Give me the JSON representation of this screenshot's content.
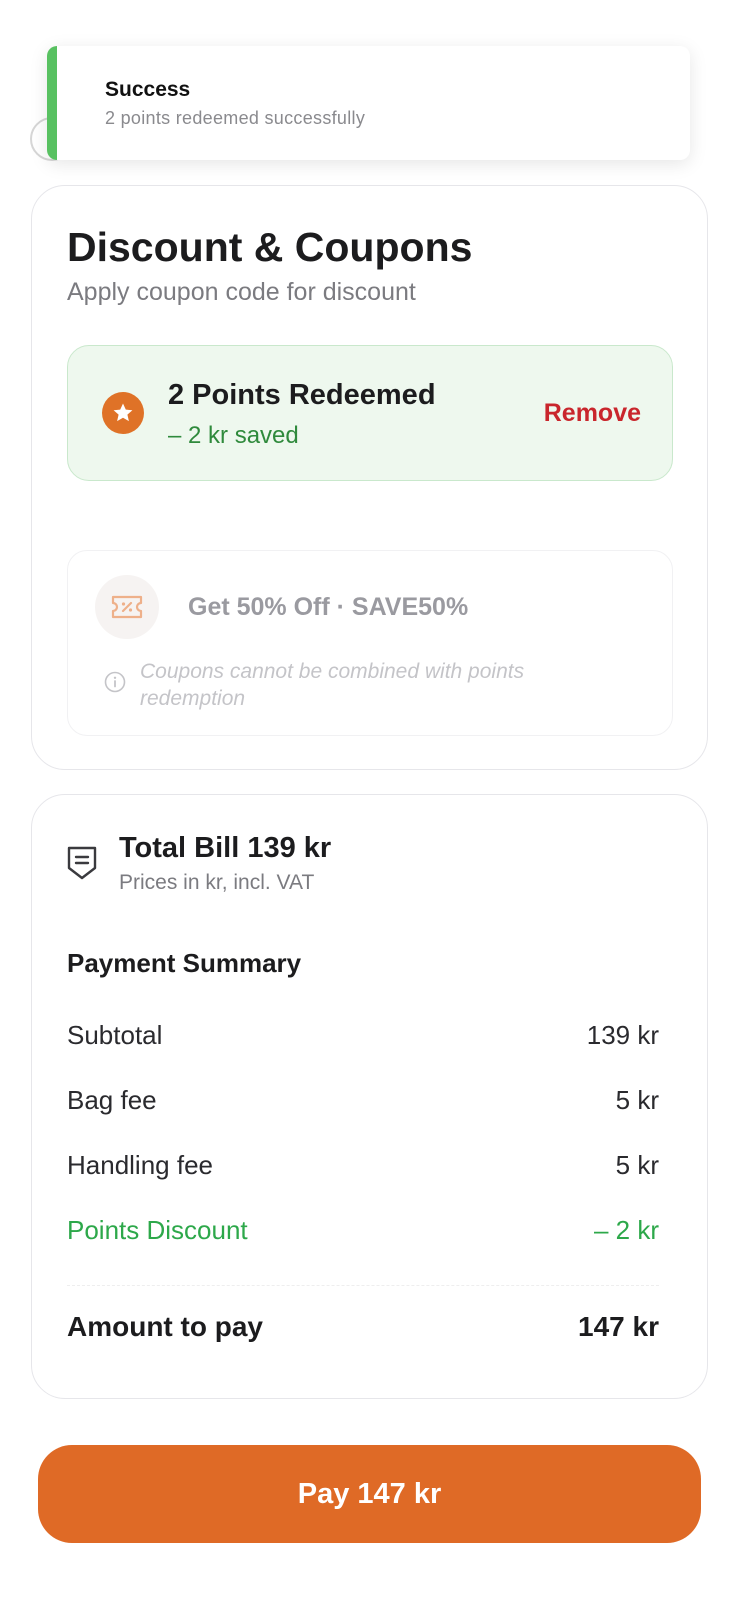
{
  "toast": {
    "title": "Success",
    "message": "2 points redeemed successfully",
    "accent_color": "#58c161"
  },
  "discount": {
    "title": "Discount & Coupons",
    "subtitle": "Apply coupon code for discount",
    "points": {
      "icon": "star-icon",
      "title": "2 Points Redeemed",
      "saved": "– 2 kr saved",
      "remove_label": "Remove"
    },
    "coupon": {
      "icon": "coupon-ticket-icon",
      "label": "Get 50% Off · SAVE50%",
      "note": "Coupons cannot be combined with points redemption",
      "disabled": true
    }
  },
  "bill": {
    "icon": "receipt-shield-icon",
    "title": "Total Bill 139 kr",
    "subtitle": "Prices in kr, incl. VAT",
    "summary_title": "Payment Summary",
    "rows": [
      {
        "label": "Subtotal",
        "value": "139 kr"
      },
      {
        "label": "Bag fee",
        "value": "5 kr"
      },
      {
        "label": "Handling fee",
        "value": "5 kr"
      },
      {
        "label": "Points Discount",
        "value": "– 2 kr",
        "highlight": "#2da84a"
      }
    ],
    "total_label": "Amount to pay",
    "total_value": "147 kr"
  },
  "pay_button": {
    "label": "Pay 147 kr",
    "color": "#df6a26"
  }
}
